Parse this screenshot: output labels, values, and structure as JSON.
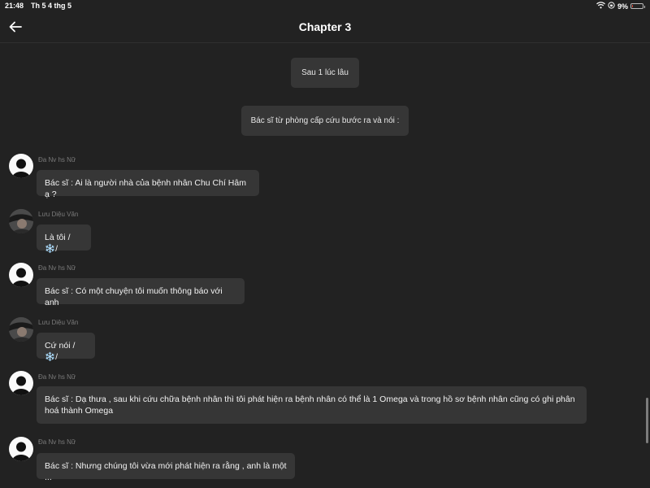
{
  "status": {
    "time": "21:48",
    "date": "Th 5 4 thg 5",
    "battery": "9%",
    "battery_level": 0.09,
    "battery_color": "#e74c3c"
  },
  "header": {
    "title": "Chapter 3",
    "back_icon": "arrow-left-icon"
  },
  "narration": [
    "Sau 1 lúc lâu",
    "Bác sĩ từ phòng cấp cứu bước ra và nói :"
  ],
  "messages": [
    {
      "sender": "Đa Nv hs Nữ",
      "text": "Bác sĩ : Ai là người nhà của bệnh nhân Chu Chí Hâm ạ ?"
    },
    {
      "sender": "Lưu Diệu Văn",
      "text_before": "Là tôi /",
      "emoji": "❄️",
      "text_after": "/"
    },
    {
      "sender": "Đa Nv hs Nữ",
      "text": "Bác sĩ : Có một chuyện tôi muốn thông báo với anh"
    },
    {
      "sender": "Lưu Diệu Văn",
      "text_before": "Cứ nói /",
      "emoji": "❄️",
      "text_after": "/"
    },
    {
      "sender": "Đa Nv hs Nữ",
      "text": "Bác sĩ : Dạ thưa , sau khi cứu chữa bệnh nhân thì tôi phát hiện ra bệnh nhân có thể là 1 Omega và trong hồ sơ bệnh nhân cũng có ghi phân hoá thành Omega"
    },
    {
      "sender": "Đa Nv hs Nữ",
      "text": "Bác sĩ : Nhưng chúng tôi vừa mới phát hiện ra rằng , anh là một ..."
    }
  ]
}
